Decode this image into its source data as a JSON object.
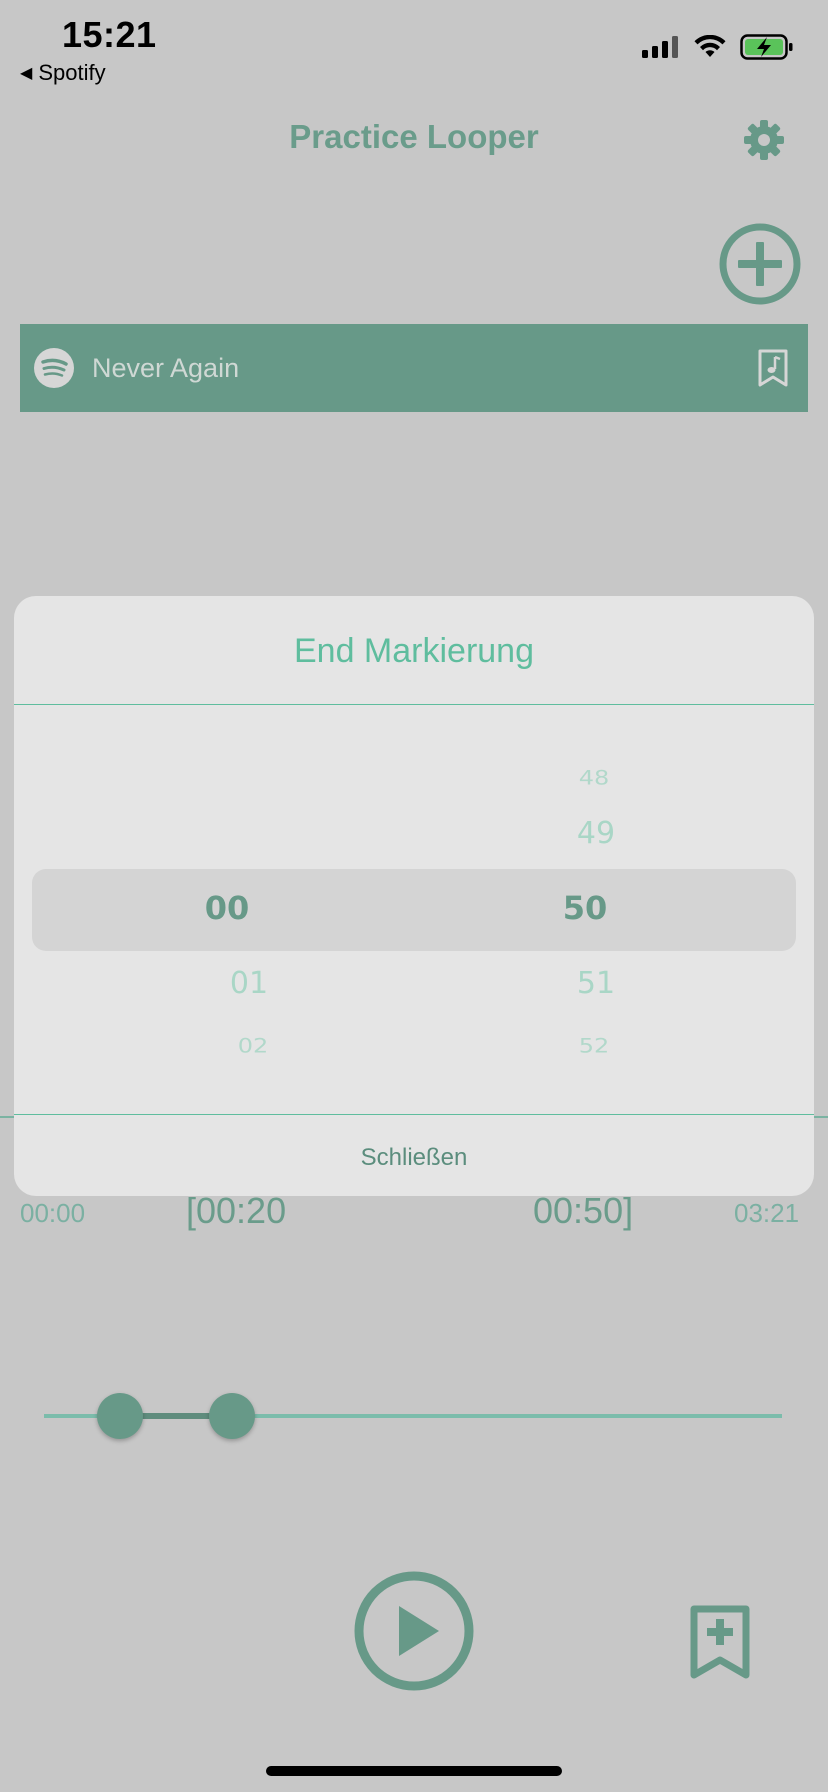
{
  "status_bar": {
    "time": "15:21",
    "back_app": "Spotify"
  },
  "header": {
    "title": "Practice Looper",
    "settings_icon": "gear-icon",
    "add_icon": "plus-circle-icon"
  },
  "track": {
    "title": "Never Again",
    "source_icon": "spotify-icon",
    "action_icon": "music-sheet-icon"
  },
  "timeline": {
    "start": "00:00",
    "loop_start": "[00:20",
    "loop_end": "00:50]",
    "end": "03:21"
  },
  "modal": {
    "title": "End Markierung",
    "minutes": {
      "selected": "00",
      "below": [
        "01",
        "02"
      ]
    },
    "seconds": {
      "above": [
        "48",
        "49"
      ],
      "selected": "50",
      "below": [
        "51",
        "52"
      ]
    },
    "close_label": "Schließen"
  },
  "colors": {
    "accent": "#679988",
    "accent_light": "#5fbd9e",
    "background": "#c7c7c7",
    "modal_bg": "#e5e5e5"
  }
}
